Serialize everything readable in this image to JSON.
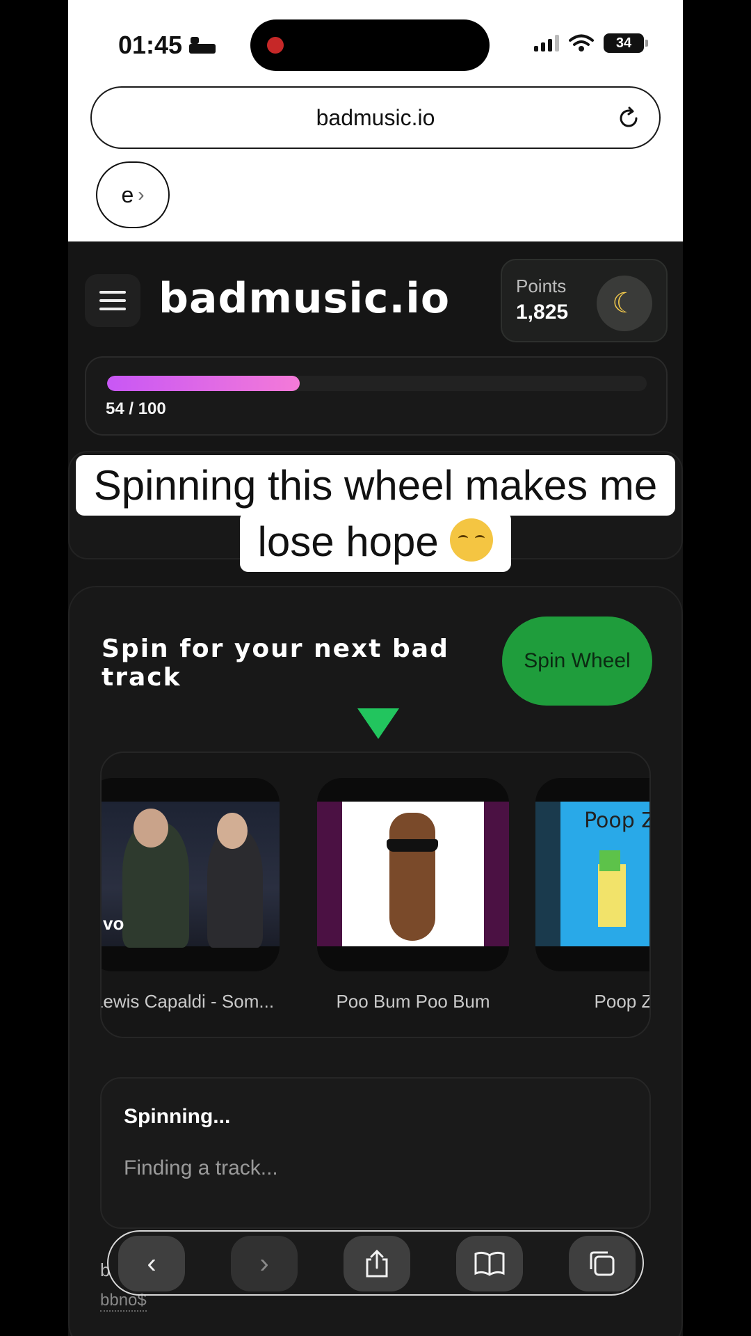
{
  "status_bar": {
    "time": "01:45",
    "battery": "34"
  },
  "browser": {
    "url": "badmusic.io",
    "tab_chip_label": "e"
  },
  "site": {
    "brand": "badmusic.io",
    "points_label": "Points",
    "points_value": "1,825",
    "progress": {
      "current": 54,
      "max": 100,
      "text": "54 / 100"
    }
  },
  "caption": {
    "line1": "Spinning this wheel makes me",
    "line2": "lose hope"
  },
  "spin": {
    "title": "Spin for your next bad track",
    "button_label": "Spin Wheel",
    "tracks": [
      {
        "name": "Lewis Capaldi - Som...",
        "thumb_text": "vo"
      },
      {
        "name": "Poo Bum Poo Bum"
      },
      {
        "name": "Poop Zor",
        "thumb_text": "Poop Zom"
      }
    ],
    "status_title": "Spinning...",
    "status_text": "Finding a track..."
  },
  "bottom_peek": {
    "letter": "b",
    "artist": "bbno$"
  },
  "colors": {
    "accent_green": "#22c55e",
    "progress_start": "#c857f5",
    "progress_end": "#f47ad8",
    "background": "#151515"
  }
}
